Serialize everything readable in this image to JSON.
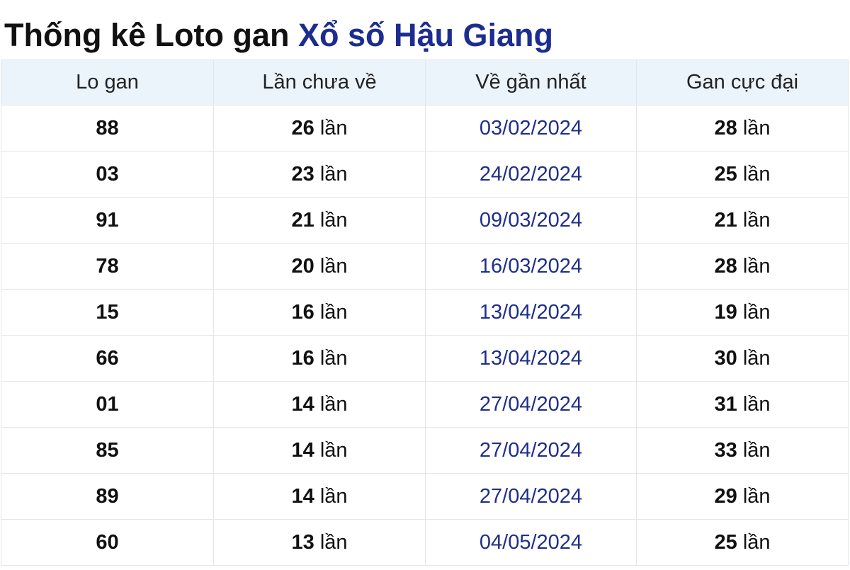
{
  "title": {
    "prefix": "Thống kê Loto gan",
    "accent": "Xổ số Hậu Giang"
  },
  "table": {
    "headers": [
      "Lo gan",
      "Lần chưa về",
      "Về gần nhất",
      "Gan cực đại"
    ],
    "unit": "lần",
    "rows": [
      {
        "lo": "88",
        "missed": "26",
        "last": "03/02/2024",
        "max": "28"
      },
      {
        "lo": "03",
        "missed": "23",
        "last": "24/02/2024",
        "max": "25"
      },
      {
        "lo": "91",
        "missed": "21",
        "last": "09/03/2024",
        "max": "21"
      },
      {
        "lo": "78",
        "missed": "20",
        "last": "16/03/2024",
        "max": "28"
      },
      {
        "lo": "15",
        "missed": "16",
        "last": "13/04/2024",
        "max": "19"
      },
      {
        "lo": "66",
        "missed": "16",
        "last": "13/04/2024",
        "max": "30"
      },
      {
        "lo": "01",
        "missed": "14",
        "last": "27/04/2024",
        "max": "31"
      },
      {
        "lo": "85",
        "missed": "14",
        "last": "27/04/2024",
        "max": "33"
      },
      {
        "lo": "89",
        "missed": "14",
        "last": "27/04/2024",
        "max": "29"
      },
      {
        "lo": "60",
        "missed": "13",
        "last": "04/05/2024",
        "max": "25"
      }
    ]
  },
  "colors": {
    "accent": "#1c2d8f",
    "date": "#1f2f8a",
    "header_bg": "#ebf3fb",
    "border": "#e3e6ea"
  }
}
